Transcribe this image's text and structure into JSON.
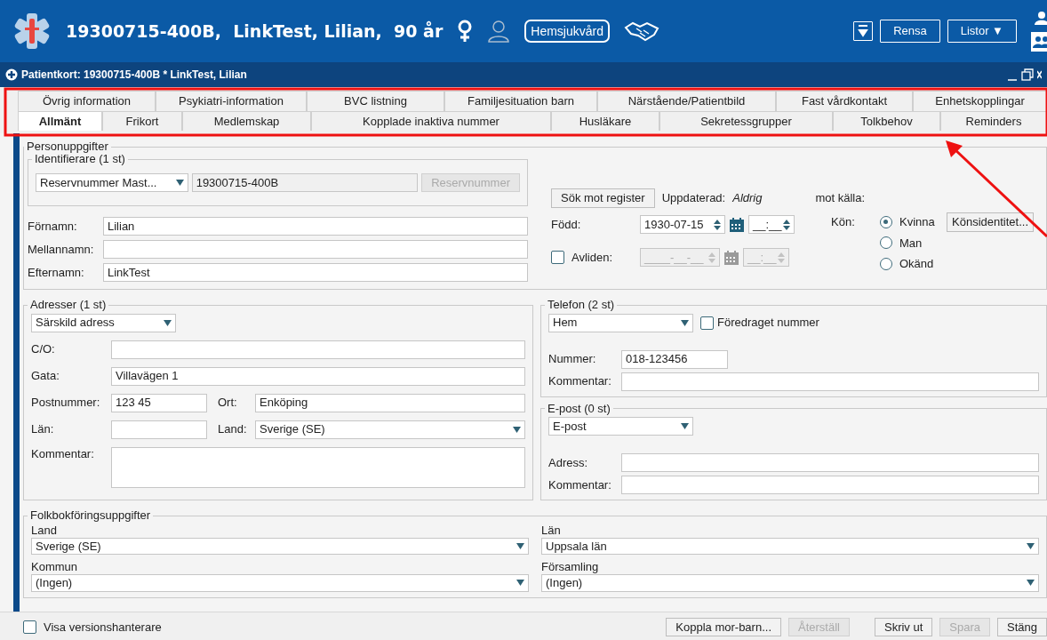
{
  "header": {
    "title": "19300715-400B,  LinkTest, Lilian,  90 år",
    "badge": "Hemsjukvård",
    "buttons": [
      {
        "label": "Rensa"
      },
      {
        "label": "Listor",
        "caret": "▼"
      }
    ]
  },
  "subheader": {
    "title": "Patientkort: 19300715-400B * LinkTest, Lilian"
  },
  "tab_strip": {
    "upper_row": [
      {
        "label": "Övrig information",
        "selected": false
      },
      {
        "label": "Psykiatri-information",
        "selected": false
      },
      {
        "label": "BVC listning",
        "selected": false
      },
      {
        "label": "Familjesituation barn",
        "selected": false
      },
      {
        "label": "Närstående/Patientbild",
        "selected": false
      },
      {
        "label": "Fast vårdkontakt",
        "selected": false
      },
      {
        "label": "Enhetskopplingar",
        "selected": false
      }
    ],
    "lower_row": [
      {
        "label": "Allmänt",
        "selected": true
      },
      {
        "label": "Frikort",
        "selected": false
      },
      {
        "label": "Medlemskap",
        "selected": false
      },
      {
        "label": "Kopplade inaktiva nummer",
        "selected": false
      },
      {
        "label": "Husläkare",
        "selected": false
      },
      {
        "label": "Sekretessgrupper",
        "selected": false
      },
      {
        "label": "Tolkbehov",
        "selected": false
      },
      {
        "label": "Reminders",
        "selected": false
      }
    ]
  },
  "person": {
    "legend": "Personuppgifter",
    "identifier": {
      "legend": "Identifierare (1 st)",
      "type": "Reservnummer Mast...",
      "number": "19300715-400B",
      "button": {
        "label": "Reservnummer",
        "disabled": true
      }
    },
    "names": [
      {
        "label": "Förnamn:",
        "value": "Lilian"
      },
      {
        "label": "Mellannamn:"
      },
      {
        "label": "Efternamn:",
        "value": "LinkTest"
      }
    ],
    "search_button": "Sök mot register",
    "updated_label": "Uppdaterad:",
    "updated_value": "Aldrig",
    "source_label": "mot källa:",
    "born": {
      "label": "Född:",
      "date": "1930-07-15",
      "time": "__:__"
    },
    "deceased": {
      "label": "Avliden:",
      "checked": false,
      "date": "____-__-__",
      "time": "__:__"
    },
    "gender": {
      "label": "Kön:",
      "options": [
        {
          "label": "Kvinna",
          "selected": true
        },
        {
          "label": "Man",
          "selected": false
        },
        {
          "label": "Okänd",
          "selected": false
        }
      ],
      "button": "Könsidentitet..."
    }
  },
  "address": {
    "legend": "Adresser (1 st)",
    "type": "Särskild adress",
    "co": {
      "label": "C/O:"
    },
    "street": {
      "label": "Gata:",
      "value": "Villavägen 1"
    },
    "postal": {
      "label": "Postnummer:",
      "value": "123 45"
    },
    "city": {
      "label": "Ort:",
      "value": "Enköping"
    },
    "county": {
      "label": "Län:"
    },
    "country": {
      "label": "Land:",
      "value": "Sverige (SE)"
    },
    "comment": {
      "label": "Kommentar:"
    }
  },
  "phone": {
    "legend": "Telefon (2 st)",
    "type": "Hem",
    "preferred": {
      "label": "Föredraget nummer",
      "checked": false
    },
    "number": {
      "label": "Nummer:",
      "value": "018-123456"
    },
    "comment": {
      "label": "Kommentar:"
    }
  },
  "email": {
    "legend": "E-post (0 st)",
    "type": "E-post",
    "address": {
      "label": "Adress:"
    },
    "comment": {
      "label": "Kommentar:"
    }
  },
  "registry": {
    "legend": "Folkbokföringsuppgifter",
    "fields": [
      {
        "label": "Land",
        "value": "Sverige (SE)"
      },
      {
        "label": "Län",
        "value": "Uppsala län"
      },
      {
        "label": "Kommun",
        "value": "(Ingen)"
      },
      {
        "label": "Församling",
        "value": "(Ingen)"
      }
    ]
  },
  "footer": {
    "checkbox": {
      "label": "Visa versionshanterare",
      "checked": false
    },
    "buttons": [
      {
        "label": "Koppla mor-barn...",
        "disabled": false
      },
      {
        "label": "Återställ",
        "disabled": true
      },
      {
        "label": "Skriv ut",
        "disabled": false
      },
      {
        "label": "Spara",
        "disabled": true
      },
      {
        "label": "Stäng",
        "disabled": false
      }
    ]
  }
}
